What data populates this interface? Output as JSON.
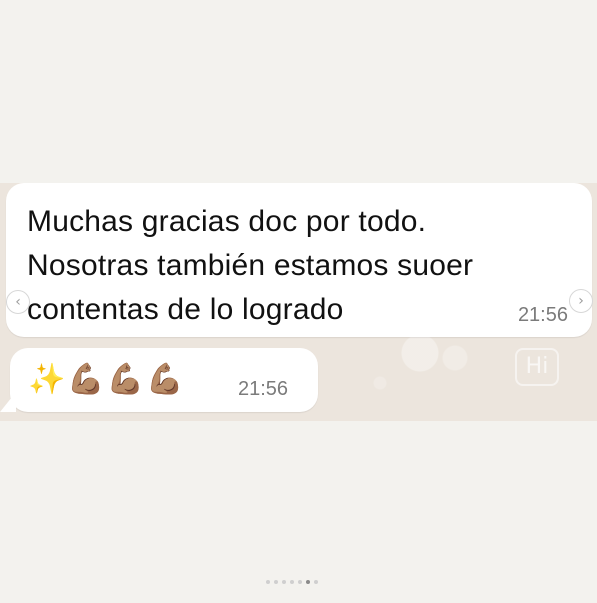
{
  "messages": [
    {
      "lines": [
        "Muchas gracias doc por todo.",
        "Nosotras también estamos suoer",
        "contentas de lo logrado"
      ],
      "time": "21:56"
    },
    {
      "emojis": "✨💪🏽💪🏽💪🏽",
      "time": "21:56"
    }
  ],
  "navigation": {
    "prev_icon": "chevron-left-icon",
    "prev_glyph": "‹",
    "next_icon": "chevron-right-icon",
    "next_glyph": "›"
  },
  "carousel": {
    "total_slides": 7,
    "active_index": 5
  },
  "colors": {
    "page_background": "#f3f2ee",
    "chat_wallpaper": "#ece5dd",
    "bubble": "#ffffff",
    "message_text": "#111111",
    "timestamp": "#7b7b7b"
  }
}
